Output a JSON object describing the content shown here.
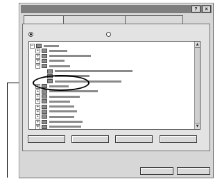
{
  "window": {
    "title": "",
    "help_button": "?",
    "close_button": "×"
  },
  "tabs": [
    {
      "label": "",
      "active": true
    },
    {
      "label": "",
      "active": false
    },
    {
      "label": "",
      "active": false
    }
  ],
  "view_options": [
    {
      "label": "",
      "selected": true
    },
    {
      "label": "",
      "selected": false
    }
  ],
  "tree": {
    "root_label": "",
    "nodes": [
      {
        "label": "",
        "expanded": false
      },
      {
        "label": "",
        "expanded": false
      },
      {
        "label": "",
        "expanded": false
      },
      {
        "label": "",
        "expanded": true
      },
      {
        "label": "",
        "expanded": false
      },
      {
        "label": "",
        "expanded": false
      },
      {
        "label": "",
        "expanded": false
      },
      {
        "label": "",
        "expanded": false
      },
      {
        "label": "",
        "expanded": false
      },
      {
        "label": "",
        "expanded": false
      },
      {
        "label": "",
        "expanded": false
      },
      {
        "label": "",
        "expanded": false
      },
      {
        "label": "",
        "expanded": false
      },
      {
        "label": "",
        "expanded": false
      },
      {
        "label": "",
        "expanded": false
      },
      {
        "label": "",
        "expanded": false
      }
    ],
    "children": [
      {
        "label": ""
      },
      {
        "label": ""
      },
      {
        "label": ""
      }
    ],
    "highlighted_child": 1
  },
  "panel_buttons": [
    {
      "label": ""
    },
    {
      "label": ""
    },
    {
      "label": ""
    },
    {
      "label": ""
    }
  ],
  "dialog_buttons": {
    "ok": "",
    "cancel": ""
  }
}
